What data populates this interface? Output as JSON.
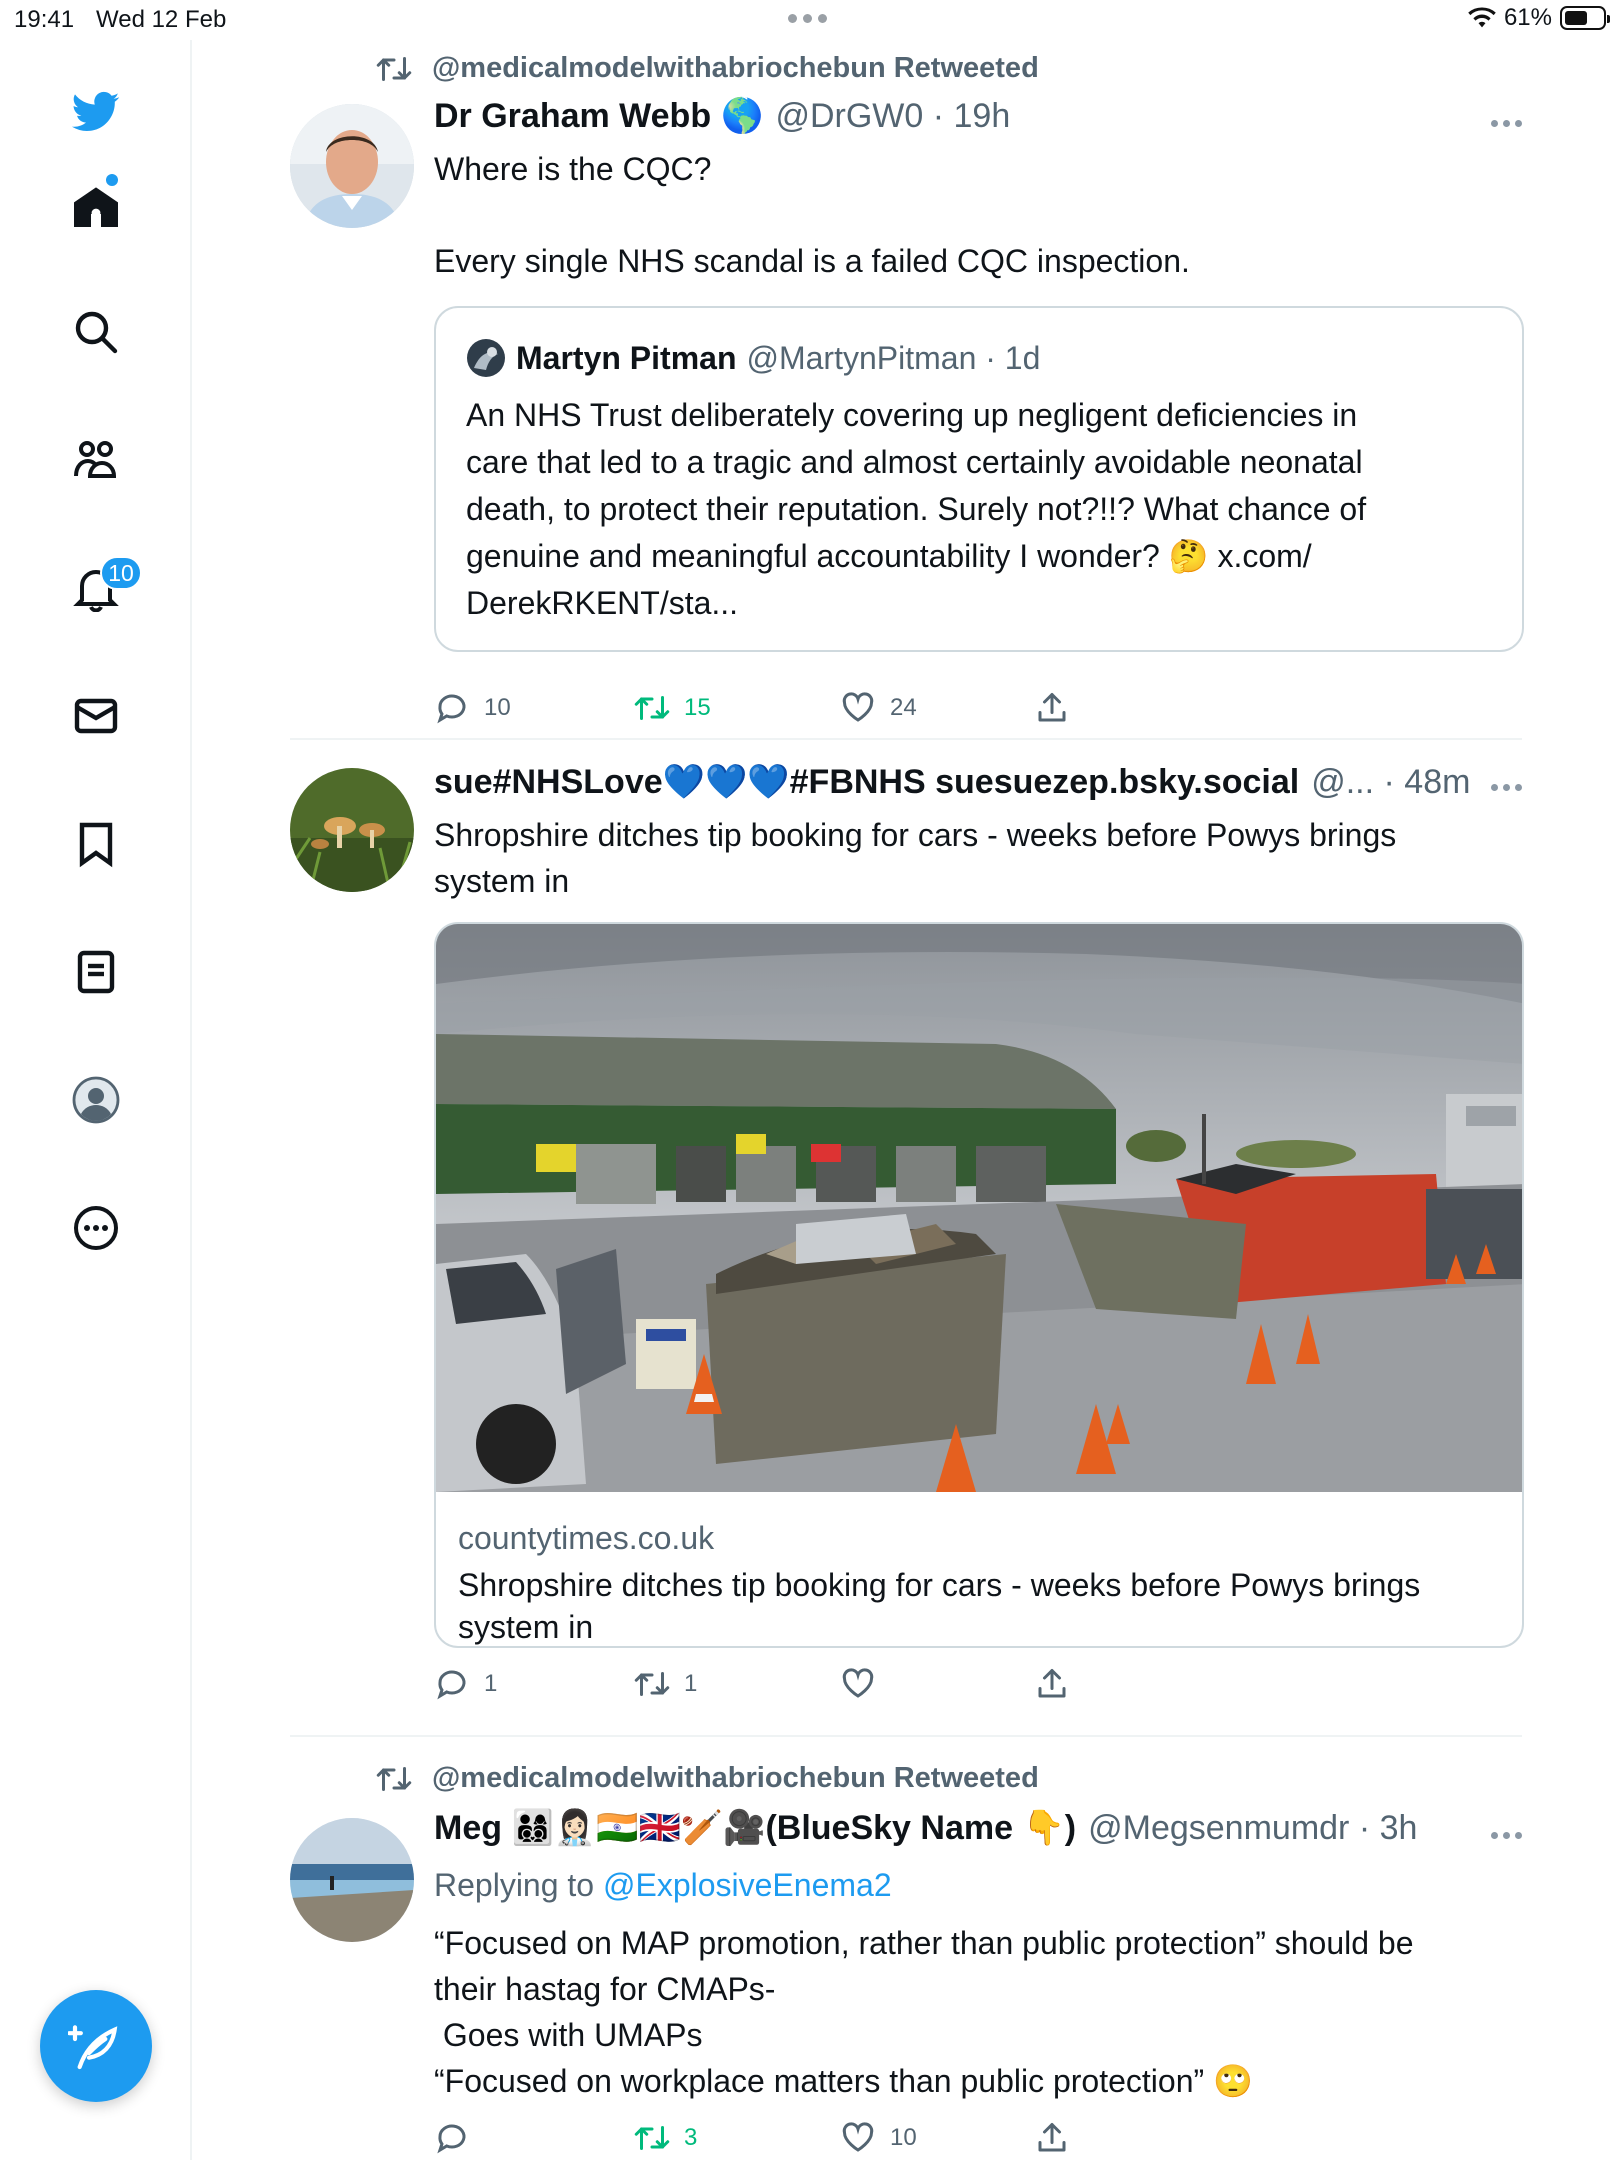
{
  "status_bar": {
    "time": "19:41",
    "date": "Wed 12 Feb",
    "battery": "61%"
  },
  "sidebar": {
    "items": [
      {
        "name": "twitter-logo"
      },
      {
        "name": "home"
      },
      {
        "name": "search"
      },
      {
        "name": "communities"
      },
      {
        "name": "notifications",
        "badge": "10"
      },
      {
        "name": "messages"
      },
      {
        "name": "bookmarks"
      },
      {
        "name": "lists"
      },
      {
        "name": "profile"
      },
      {
        "name": "more"
      }
    ],
    "accent": "#1d9bf0"
  },
  "tweets": [
    {
      "retweeted_by": "@medicalmodelwithabriochebun Retweeted",
      "name": "Dr Graham Webb",
      "name_emoji": "🌎",
      "handle_time": "@DrGW0 · 19h",
      "lines": [
        "Where is the CQC?",
        "Every single NHS scandal is a failed CQC inspection."
      ],
      "quote": {
        "name": "Martyn Pitman",
        "handle_time": "@MartynPitman · 1d",
        "lines": [
          "An NHS Trust deliberately covering up negligent  deficiencies in",
          "care that led to a tragic and almost certainly avoidable neonatal",
          "death, to protect their reputation. Surely not?!!? What chance of",
          "genuine and meaningful accountability I wonder? 🤔 x.com/",
          "DerekRKENT/sta..."
        ]
      },
      "replies": "10",
      "retweets": "15",
      "likes": "24"
    },
    {
      "name": "sue#NHSLove💙💙💙#FBNHS suesuezep.bsky.social",
      "handle_time": "@... · 48m",
      "lines": [
        "Shropshire ditches tip booking for cars - weeks before Powys brings",
        "system in"
      ],
      "card": {
        "domain": "countytimes.co.uk",
        "title_lines": [
          "Shropshire ditches tip booking for cars - weeks before Powys brings",
          "system in"
        ]
      },
      "replies": "1",
      "retweets": "1",
      "likes": ""
    },
    {
      "retweeted_by": "@medicalmodelwithabriochebun Retweeted",
      "name": "Meg 👨‍👩‍👦‍👦👩🏻‍⚕️🇮🇳🇬🇧🏏🎥(BlueSky Name 👇)",
      "handle_time": "@Megsenmumdr · 3h",
      "replying_prefix": "Replying to",
      "replying_to": "@ExplosiveEnema2",
      "lines": [
        "“Focused on MAP promotion, rather than public protection” should be",
        "their hastag for CMAPs-",
        " Goes with UMAPs",
        "“Focused on workplace matters than public protection” 🙄"
      ],
      "replies": "",
      "retweets": "3",
      "likes": "10"
    }
  ]
}
